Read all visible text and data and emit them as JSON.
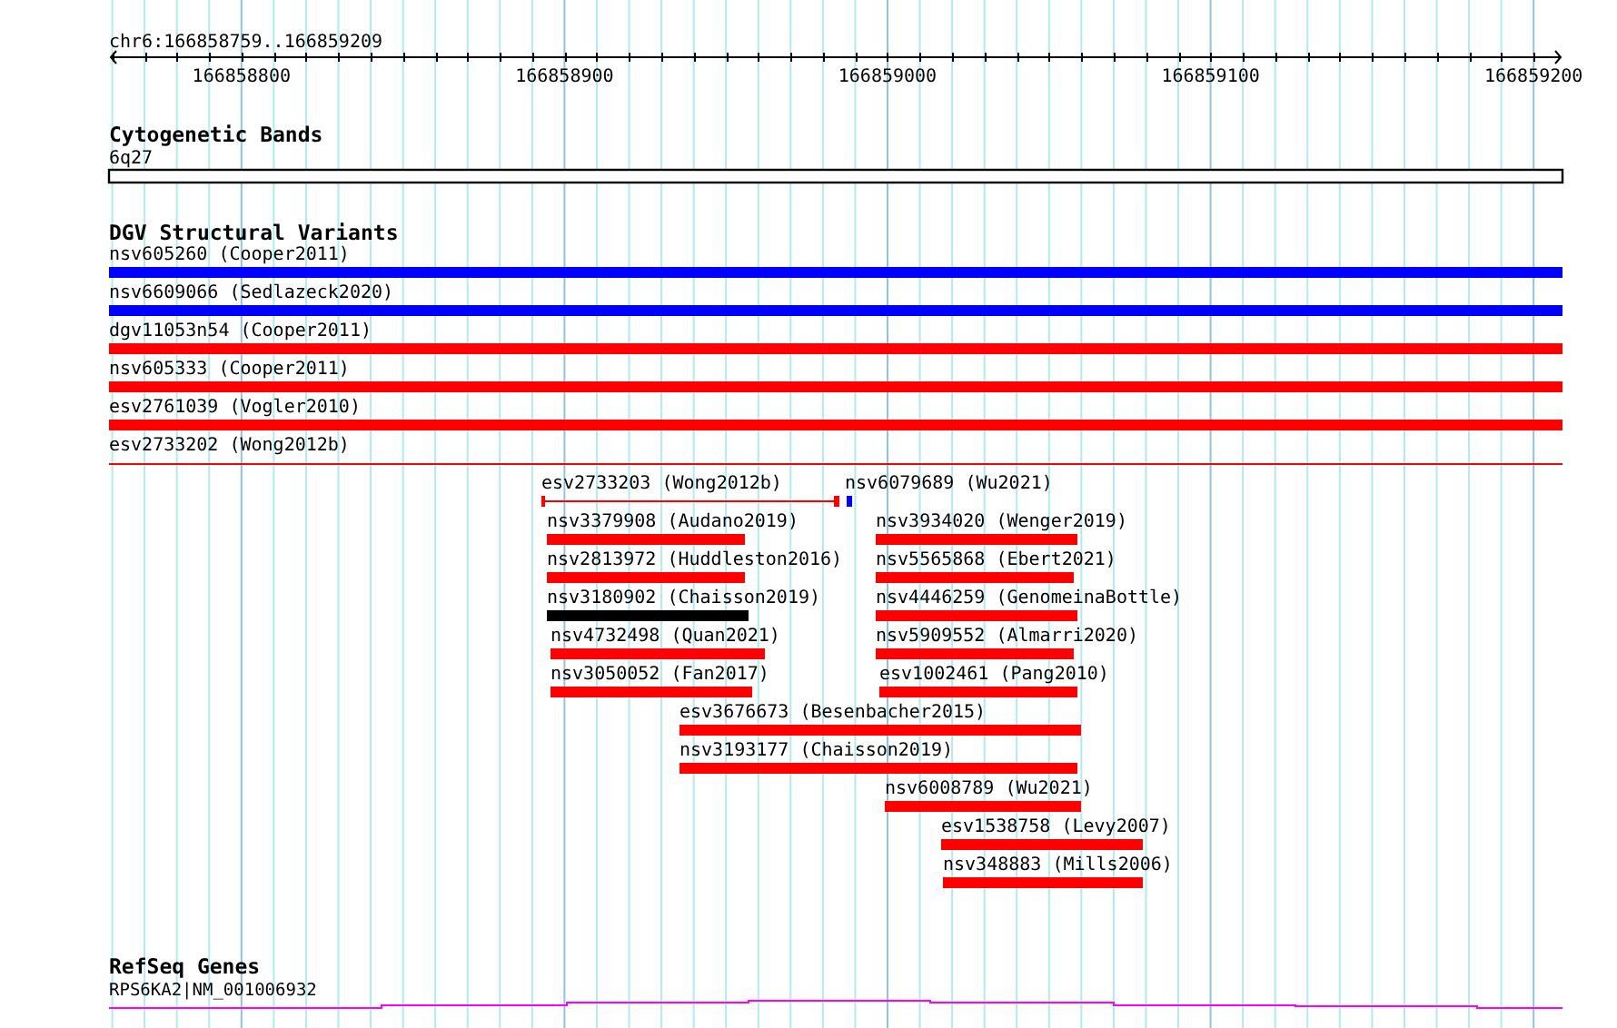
{
  "ruler": {
    "position": "chr6:166858759..166859209",
    "tick_labels": [
      "166858800",
      "166858900",
      "166859000",
      "166859100",
      "166859200"
    ]
  },
  "cytogenetic_bands": {
    "title": "Cytogenetic Bands",
    "band": "6q27"
  },
  "dgv_structural_variants": {
    "title": "DGV Structural Variants",
    "features": [
      {
        "label": "nsv605260 (Cooper2011)",
        "kind": "bar",
        "color": "#0000ff"
      },
      {
        "label": "nsv6609066 (Sedlazeck2020)",
        "kind": "bar",
        "color": "#0000ff"
      },
      {
        "label": "dgv11053n54 (Cooper2011)",
        "kind": "bar",
        "color": "#ff0000"
      },
      {
        "label": "nsv605333 (Cooper2011)",
        "kind": "bar",
        "color": "#ff0000"
      },
      {
        "label": "esv2761039 (Vogler2010)",
        "kind": "bar",
        "color": "#ff0000"
      },
      {
        "label": "esv2733202 (Wong2012b)",
        "kind": "line",
        "color": "#ff0000"
      },
      {
        "label": "esv2733203 (Wong2012b)",
        "kind": "span",
        "color": "#ff0000"
      },
      {
        "label": "nsv6079689 (Wu2021)",
        "kind": "bar",
        "color": "#0000ff"
      },
      {
        "label": "nsv3379908 (Audano2019)",
        "kind": "bar",
        "color": "#ff0000"
      },
      {
        "label": "nsv3934020 (Wenger2019)",
        "kind": "bar",
        "color": "#ff0000"
      },
      {
        "label": "nsv2813972 (Huddleston2016)",
        "kind": "bar",
        "color": "#ff0000"
      },
      {
        "label": "nsv5565868 (Ebert2021)",
        "kind": "bar",
        "color": "#ff0000"
      },
      {
        "label": "nsv3180902 (Chaisson2019)",
        "kind": "bar",
        "color": "#000000"
      },
      {
        "label": "nsv4446259 (GenomeinaBottle)",
        "kind": "bar",
        "color": "#ff0000"
      },
      {
        "label": "nsv4732498 (Quan2021)",
        "kind": "bar",
        "color": "#ff0000"
      },
      {
        "label": "nsv5909552 (Almarri2020)",
        "kind": "bar",
        "color": "#ff0000"
      },
      {
        "label": "nsv3050052 (Fan2017)",
        "kind": "bar",
        "color": "#ff0000"
      },
      {
        "label": "esv1002461 (Pang2010)",
        "kind": "bar",
        "color": "#ff0000"
      },
      {
        "label": "esv3676673 (Besenbacher2015)",
        "kind": "bar",
        "color": "#ff0000"
      },
      {
        "label": "nsv3193177 (Chaisson2019)",
        "kind": "bar",
        "color": "#ff0000"
      },
      {
        "label": "nsv6008789 (Wu2021)",
        "kind": "bar",
        "color": "#ff0000"
      },
      {
        "label": "esv1538758 (Levy2007)",
        "kind": "bar",
        "color": "#ff0000"
      },
      {
        "label": "nsv348883 (Mills2006)",
        "kind": "bar",
        "color": "#ff0000"
      }
    ]
  },
  "refseq_genes": {
    "title": "RefSeq Genes",
    "gene": "RPS6KA2|NM_001006932"
  }
}
